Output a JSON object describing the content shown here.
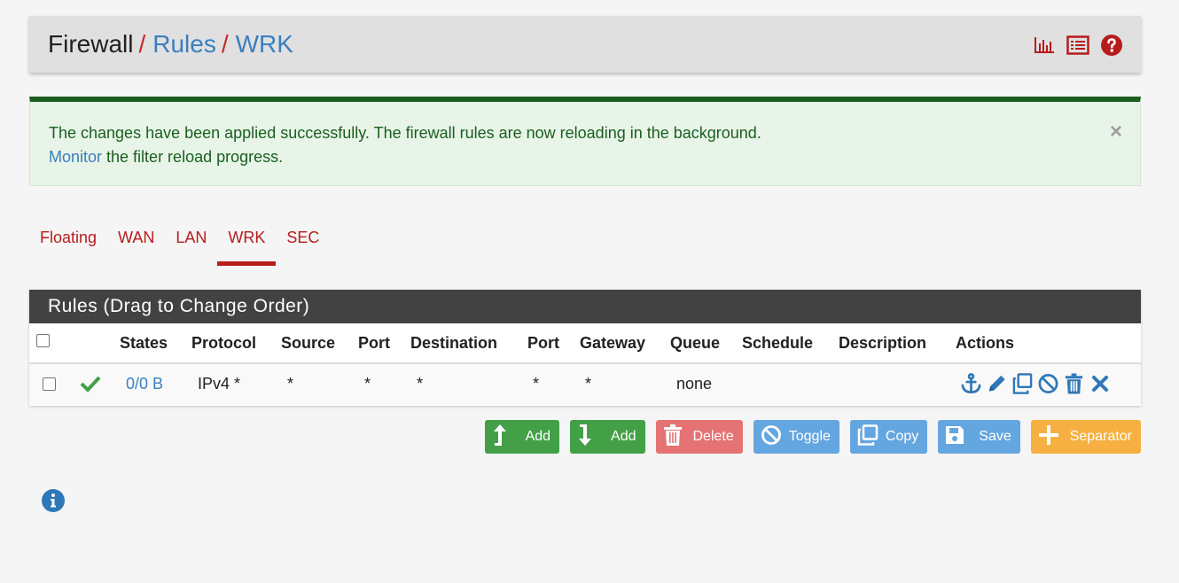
{
  "breadcrumb": {
    "root": "Firewall",
    "separator": "/",
    "level2": "Rules",
    "level3": "WRK"
  },
  "header_icons": [
    "bar-chart-icon",
    "list-icon",
    "help-icon"
  ],
  "alert": {
    "message": "The changes have been applied successfully. The firewall rules are now reloading in the background.",
    "link_text": "Monitor",
    "link_suffix": " the filter reload progress.",
    "close": "×"
  },
  "tabs": [
    {
      "label": "Floating",
      "active": false
    },
    {
      "label": "WAN",
      "active": false
    },
    {
      "label": "LAN",
      "active": false
    },
    {
      "label": "WRK",
      "active": true
    },
    {
      "label": "SEC",
      "active": false
    }
  ],
  "panel": {
    "title": "Rules (Drag to Change Order)"
  },
  "table": {
    "headers": [
      "States",
      "Protocol",
      "Source",
      "Port",
      "Destination",
      "Port",
      "Gateway",
      "Queue",
      "Schedule",
      "Description",
      "Actions"
    ],
    "rows": [
      {
        "status": "pass",
        "states": "0/0 B",
        "protocol": "IPv4 *",
        "source": "*",
        "source_port": "*",
        "destination": "*",
        "destination_port": "*",
        "gateway": "*",
        "queue": "none",
        "schedule": "",
        "description": ""
      }
    ],
    "row_actions": [
      "anchor-icon",
      "pencil-icon",
      "copy-icon",
      "disable-icon",
      "trash-icon",
      "delete-x-icon"
    ]
  },
  "buttons": {
    "add_top": "Add",
    "add_bottom": "Add",
    "delete": "Delete",
    "toggle": "Toggle",
    "copy": "Copy",
    "save": "Save",
    "separator": "Separator"
  },
  "colors": {
    "accent_red": "#b71c1c",
    "link_blue": "#3a7fbf",
    "success_green": "#1b5e20",
    "panel_dark": "#424242",
    "btn_green": "#43a047",
    "btn_red": "#e57373",
    "btn_blue": "#64a6e0",
    "btn_orange": "#f5b041"
  }
}
